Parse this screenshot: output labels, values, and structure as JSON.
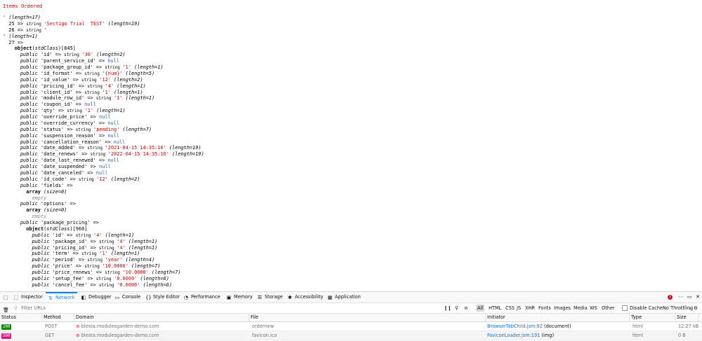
{
  "dump": {
    "title": "Items Ordered",
    "lines": [
      [
        {
          "t": "' "
        },
        {
          "t": "(length=17)",
          "c": "it"
        }
      ],
      [
        {
          "t": "  25 => "
        },
        {
          "t": "string ",
          "c": "ty"
        },
        {
          "t": "'Sectigo Trial  TEST'",
          "c": "str"
        },
        {
          "t": " "
        },
        {
          "t": "(length=19)",
          "c": "it"
        }
      ],
      [
        {
          "t": "  26 => "
        },
        {
          "t": "string ",
          "c": "ty"
        },
        {
          "t": "'",
          "c": "str"
        }
      ],
      [
        {
          "t": "' "
        },
        {
          "t": "(length=1)",
          "c": "it"
        }
      ],
      [
        {
          "t": "  27 =>"
        }
      ],
      [
        {
          "t": "    "
        },
        {
          "t": "object",
          "c": "b"
        },
        {
          "t": "(",
          "c": ""
        },
        {
          "t": "stdClass",
          "c": "it"
        },
        {
          "t": ")[845]"
        }
      ],
      [
        {
          "t": "      "
        },
        {
          "t": "public",
          "c": "kw"
        },
        {
          "t": " 'id' => "
        },
        {
          "t": "string ",
          "c": "ty"
        },
        {
          "t": "'30'",
          "c": "str"
        },
        {
          "t": " "
        },
        {
          "t": "(length=2)",
          "c": "it"
        }
      ],
      [
        {
          "t": "      "
        },
        {
          "t": "public",
          "c": "kw"
        },
        {
          "t": " 'parent_service_id' => "
        },
        {
          "t": "null",
          "c": "nul"
        }
      ],
      [
        {
          "t": "      "
        },
        {
          "t": "public",
          "c": "kw"
        },
        {
          "t": " 'package_group_id' => "
        },
        {
          "t": "string ",
          "c": "ty"
        },
        {
          "t": "'1'",
          "c": "str"
        },
        {
          "t": " "
        },
        {
          "t": "(length=1)",
          "c": "it"
        }
      ],
      [
        {
          "t": "      "
        },
        {
          "t": "public",
          "c": "kw"
        },
        {
          "t": " 'id_format' => "
        },
        {
          "t": "string ",
          "c": "ty"
        },
        {
          "t": "'{num}'",
          "c": "str"
        },
        {
          "t": " "
        },
        {
          "t": "(length=5)",
          "c": "it"
        }
      ],
      [
        {
          "t": "      "
        },
        {
          "t": "public",
          "c": "kw"
        },
        {
          "t": " 'id_value' => "
        },
        {
          "t": "string ",
          "c": "ty"
        },
        {
          "t": "'12'",
          "c": "str"
        },
        {
          "t": " "
        },
        {
          "t": "(length=2)",
          "c": "it"
        }
      ],
      [
        {
          "t": "      "
        },
        {
          "t": "public",
          "c": "kw"
        },
        {
          "t": " 'pricing_id' => "
        },
        {
          "t": "string ",
          "c": "ty"
        },
        {
          "t": "'4'",
          "c": "str"
        },
        {
          "t": " "
        },
        {
          "t": "(length=1)",
          "c": "it"
        }
      ],
      [
        {
          "t": "      "
        },
        {
          "t": "public",
          "c": "kw"
        },
        {
          "t": " 'client_id' => "
        },
        {
          "t": "string ",
          "c": "ty"
        },
        {
          "t": "'1'",
          "c": "str"
        },
        {
          "t": " "
        },
        {
          "t": "(length=1)",
          "c": "it"
        }
      ],
      [
        {
          "t": "      "
        },
        {
          "t": "public",
          "c": "kw"
        },
        {
          "t": " 'module_row_id' => "
        },
        {
          "t": "string ",
          "c": "ty"
        },
        {
          "t": "'1'",
          "c": "str"
        },
        {
          "t": " "
        },
        {
          "t": "(length=1)",
          "c": "it"
        }
      ],
      [
        {
          "t": "      "
        },
        {
          "t": "public",
          "c": "kw"
        },
        {
          "t": " 'coupon_id' => "
        },
        {
          "t": "null",
          "c": "nul"
        }
      ],
      [
        {
          "t": "      "
        },
        {
          "t": "public",
          "c": "kw"
        },
        {
          "t": " 'qty' => "
        },
        {
          "t": "string ",
          "c": "ty"
        },
        {
          "t": "'1'",
          "c": "str"
        },
        {
          "t": " "
        },
        {
          "t": "(length=1)",
          "c": "it"
        }
      ],
      [
        {
          "t": "      "
        },
        {
          "t": "public",
          "c": "kw"
        },
        {
          "t": " 'override_price' => "
        },
        {
          "t": "null",
          "c": "nul"
        }
      ],
      [
        {
          "t": "      "
        },
        {
          "t": "public",
          "c": "kw"
        },
        {
          "t": " 'override_currency' => "
        },
        {
          "t": "null",
          "c": "nul"
        }
      ],
      [
        {
          "t": "      "
        },
        {
          "t": "public",
          "c": "kw"
        },
        {
          "t": " 'status' => "
        },
        {
          "t": "string ",
          "c": "ty"
        },
        {
          "t": "'pending'",
          "c": "str"
        },
        {
          "t": " "
        },
        {
          "t": "(length=7)",
          "c": "it"
        }
      ],
      [
        {
          "t": "      "
        },
        {
          "t": "public",
          "c": "kw"
        },
        {
          "t": " 'suspension_reason' => "
        },
        {
          "t": "null",
          "c": "nul"
        }
      ],
      [
        {
          "t": "      "
        },
        {
          "t": "public",
          "c": "kw"
        },
        {
          "t": " 'cancellation_reason' => "
        },
        {
          "t": "null",
          "c": "nul"
        }
      ],
      [
        {
          "t": "      "
        },
        {
          "t": "public",
          "c": "kw"
        },
        {
          "t": " 'date_added' => "
        },
        {
          "t": "string ",
          "c": "ty"
        },
        {
          "t": "'2021-04-15 14:35:16'",
          "c": "str"
        },
        {
          "t": " "
        },
        {
          "t": "(length=19)",
          "c": "it"
        }
      ],
      [
        {
          "t": "      "
        },
        {
          "t": "public",
          "c": "kw"
        },
        {
          "t": " 'date_renews' => "
        },
        {
          "t": "string ",
          "c": "ty"
        },
        {
          "t": "'2022-04-15 14:35:16'",
          "c": "str"
        },
        {
          "t": " "
        },
        {
          "t": "(length=19)",
          "c": "it"
        }
      ],
      [
        {
          "t": "      "
        },
        {
          "t": "public",
          "c": "kw"
        },
        {
          "t": " 'date_last_renewed' => "
        },
        {
          "t": "null",
          "c": "nul"
        }
      ],
      [
        {
          "t": "      "
        },
        {
          "t": "public",
          "c": "kw"
        },
        {
          "t": " 'date_suspended' => "
        },
        {
          "t": "null",
          "c": "nul"
        }
      ],
      [
        {
          "t": "      "
        },
        {
          "t": "public",
          "c": "kw"
        },
        {
          "t": " 'date_canceled' => "
        },
        {
          "t": "null",
          "c": "nul"
        }
      ],
      [
        {
          "t": "      "
        },
        {
          "t": "public",
          "c": "kw"
        },
        {
          "t": " 'id_code' => "
        },
        {
          "t": "string ",
          "c": "ty"
        },
        {
          "t": "'12'",
          "c": "str"
        },
        {
          "t": " "
        },
        {
          "t": "(length=2)",
          "c": "it"
        }
      ],
      [
        {
          "t": "      "
        },
        {
          "t": "public",
          "c": "kw"
        },
        {
          "t": " 'fields' =>"
        }
      ],
      [
        {
          "t": "        "
        },
        {
          "t": "array",
          "c": "b"
        },
        {
          "t": " "
        },
        {
          "t": "(size=0)",
          "c": "it"
        }
      ],
      [
        {
          "t": "          "
        },
        {
          "t": "empty",
          "c": "em"
        }
      ],
      [
        {
          "t": "      "
        },
        {
          "t": "public",
          "c": "kw"
        },
        {
          "t": " 'options' =>"
        }
      ],
      [
        {
          "t": "        "
        },
        {
          "t": "array",
          "c": "b"
        },
        {
          "t": " "
        },
        {
          "t": "(size=0)",
          "c": "it"
        }
      ],
      [
        {
          "t": "          "
        },
        {
          "t": "empty",
          "c": "em"
        }
      ],
      [
        {
          "t": "      "
        },
        {
          "t": "public",
          "c": "kw"
        },
        {
          "t": " 'package_pricing' =>"
        }
      ],
      [
        {
          "t": "        "
        },
        {
          "t": "object",
          "c": "b"
        },
        {
          "t": "("
        },
        {
          "t": "stdClass",
          "c": "it"
        },
        {
          "t": ")[960]"
        }
      ],
      [
        {
          "t": "          "
        },
        {
          "t": "public",
          "c": "kw"
        },
        {
          "t": " 'id' => "
        },
        {
          "t": "string ",
          "c": "ty"
        },
        {
          "t": "'4'",
          "c": "str"
        },
        {
          "t": " "
        },
        {
          "t": "(length=1)",
          "c": "it"
        }
      ],
      [
        {
          "t": "          "
        },
        {
          "t": "public",
          "c": "kw"
        },
        {
          "t": " 'package_id' => "
        },
        {
          "t": "string ",
          "c": "ty"
        },
        {
          "t": "'4'",
          "c": "str"
        },
        {
          "t": " "
        },
        {
          "t": "(length=1)",
          "c": "it"
        }
      ],
      [
        {
          "t": "          "
        },
        {
          "t": "public",
          "c": "kw"
        },
        {
          "t": " 'pricing_id' => "
        },
        {
          "t": "string ",
          "c": "ty"
        },
        {
          "t": "'4'",
          "c": "str"
        },
        {
          "t": " "
        },
        {
          "t": "(length=1)",
          "c": "it"
        }
      ],
      [
        {
          "t": "          "
        },
        {
          "t": "public",
          "c": "kw"
        },
        {
          "t": " 'term' => "
        },
        {
          "t": "string ",
          "c": "ty"
        },
        {
          "t": "'1'",
          "c": "str"
        },
        {
          "t": " "
        },
        {
          "t": "(length=1)",
          "c": "it"
        }
      ],
      [
        {
          "t": "          "
        },
        {
          "t": "public",
          "c": "kw"
        },
        {
          "t": " 'period' => "
        },
        {
          "t": "string ",
          "c": "ty"
        },
        {
          "t": "'year'",
          "c": "str"
        },
        {
          "t": " "
        },
        {
          "t": "(length=4)",
          "c": "it"
        }
      ],
      [
        {
          "t": "          "
        },
        {
          "t": "public",
          "c": "kw"
        },
        {
          "t": " 'price' => "
        },
        {
          "t": "string ",
          "c": "ty"
        },
        {
          "t": "'10.0000'",
          "c": "str"
        },
        {
          "t": " "
        },
        {
          "t": "(length=7)",
          "c": "it"
        }
      ],
      [
        {
          "t": "          "
        },
        {
          "t": "public",
          "c": "kw"
        },
        {
          "t": " 'price_renews' => "
        },
        {
          "t": "string ",
          "c": "ty"
        },
        {
          "t": "'10.0000'",
          "c": "str"
        },
        {
          "t": " "
        },
        {
          "t": "(length=7)",
          "c": "it"
        }
      ],
      [
        {
          "t": "          "
        },
        {
          "t": "public",
          "c": "kw"
        },
        {
          "t": " 'setup_fee' => "
        },
        {
          "t": "string ",
          "c": "ty"
        },
        {
          "t": "'0.0000'",
          "c": "str"
        },
        {
          "t": " "
        },
        {
          "t": "(length=6)",
          "c": "it"
        }
      ],
      [
        {
          "t": "          "
        },
        {
          "t": "public",
          "c": "kw"
        },
        {
          "t": " 'cancel_fee' => "
        },
        {
          "t": "string ",
          "c": "ty"
        },
        {
          "t": "'0.0000'",
          "c": "str"
        },
        {
          "t": " "
        },
        {
          "t": "(length=6)",
          "c": "it"
        }
      ]
    ]
  },
  "devtools": {
    "tabs": [
      {
        "label": "Inspector",
        "icon": "⬚",
        "name": "inspector",
        "active": false
      },
      {
        "label": "Network",
        "icon": "⇅",
        "name": "network",
        "active": true
      },
      {
        "label": "Debugger",
        "icon": "◧",
        "name": "debugger",
        "active": false
      },
      {
        "label": "Console",
        "icon": "▭",
        "name": "console",
        "active": false
      },
      {
        "label": "Style Editor",
        "icon": "{}",
        "name": "style-editor",
        "active": false
      },
      {
        "label": "Performance",
        "icon": "◔",
        "name": "performance",
        "active": false
      },
      {
        "label": "Memory",
        "icon": "▣",
        "name": "memory",
        "active": false
      },
      {
        "label": "Storage",
        "icon": "☰",
        "name": "storage",
        "active": false
      },
      {
        "label": "Accessibility",
        "icon": "✱",
        "name": "accessibility",
        "active": false
      },
      {
        "label": "Application",
        "icon": "▦",
        "name": "application",
        "active": false
      }
    ],
    "error_count": "1",
    "filter_placeholder": "Filter URLs",
    "type_filters": [
      "All",
      "HTML",
      "CSS",
      "JS",
      "XHR",
      "Fonts",
      "Images",
      "Media",
      "WS",
      "Other"
    ],
    "disable_cache": "Disable Cache",
    "throttling": "No Throttling",
    "columns": [
      "Status",
      "Method",
      "Domain",
      "File",
      "Initiator",
      "Type",
      "Size"
    ],
    "requests": [
      {
        "status": "200",
        "status_color": "#058b00",
        "method": "POST",
        "domain": "blesta.modulesgarden-demo.com",
        "file": "ordernew",
        "initiator": "BrowserTabChild.jsm:92",
        "initiator_note": " (document)",
        "type": "html",
        "size": "12.27 kB"
      },
      {
        "status": "500",
        "status_color": "#e31587",
        "method": "GET",
        "domain": "blesta.modulesgarden-demo.com",
        "file": "favicon.ico",
        "initiator": "FaviconLoader.jsm:191",
        "initiator_note": " (img)",
        "type": "html",
        "size": "0 B"
      }
    ]
  }
}
